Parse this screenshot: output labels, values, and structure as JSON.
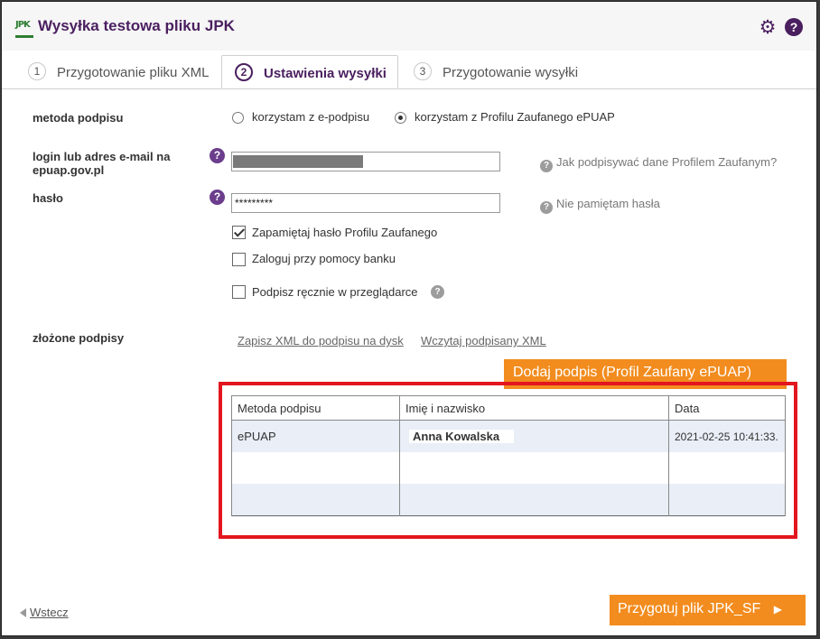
{
  "dialog": {
    "logo_text": "JPK",
    "title": "Wysyłka testowa pliku JPK"
  },
  "tabs": [
    {
      "num": "1",
      "label": "Przygotowanie pliku XML"
    },
    {
      "num": "2",
      "label": "Ustawienia wysyłki"
    },
    {
      "num": "3",
      "label": "Przygotowanie wysyłki"
    }
  ],
  "form": {
    "signature_method_label": "metoda podpisu",
    "option_esig": "korzystam z e-podpisu",
    "option_epuap": "korzystam z Profilu Zaufanego ePUAP",
    "selected_option": "epuap",
    "login_label": "login lub adres e-mail na epuap.gov.pl",
    "password_label": "hasło",
    "password_value": "*********",
    "hint_login": "Jak podpisywać dane Profilem Zaufanym?",
    "hint_password": "Nie pamiętam hasła",
    "remember_label": "Zapamiętaj hasło Profilu Zaufanego",
    "remember_checked": true,
    "bank_label": "Zaloguj przy pomocy banku",
    "bank_checked": false,
    "manual_label": "Podpisz ręcznie w przeglądarce",
    "manual_checked": false,
    "signatures_label": "złożone podpisy",
    "link_save": "Zapisz XML do podpisu na dysk",
    "link_load": "Wczytaj podpisany XML",
    "add_signature_button": "Dodaj podpis (Profil Zaufany ePUAP)"
  },
  "signatures_table": {
    "headers": [
      "Metoda podpisu",
      "Imię i nazwisko",
      "Data"
    ],
    "rows": [
      {
        "method": "ePUAP",
        "name": "Anna Kowalska",
        "date": "2021-02-25 10:41:33."
      }
    ]
  },
  "footer": {
    "back_label": "Wstecz",
    "next_button": "Przygotuj plik JPK_SF"
  },
  "colors": {
    "brand_purple": "#4a1f5f",
    "accent_orange": "#f28c1e",
    "highlight_red": "#e3161f"
  }
}
